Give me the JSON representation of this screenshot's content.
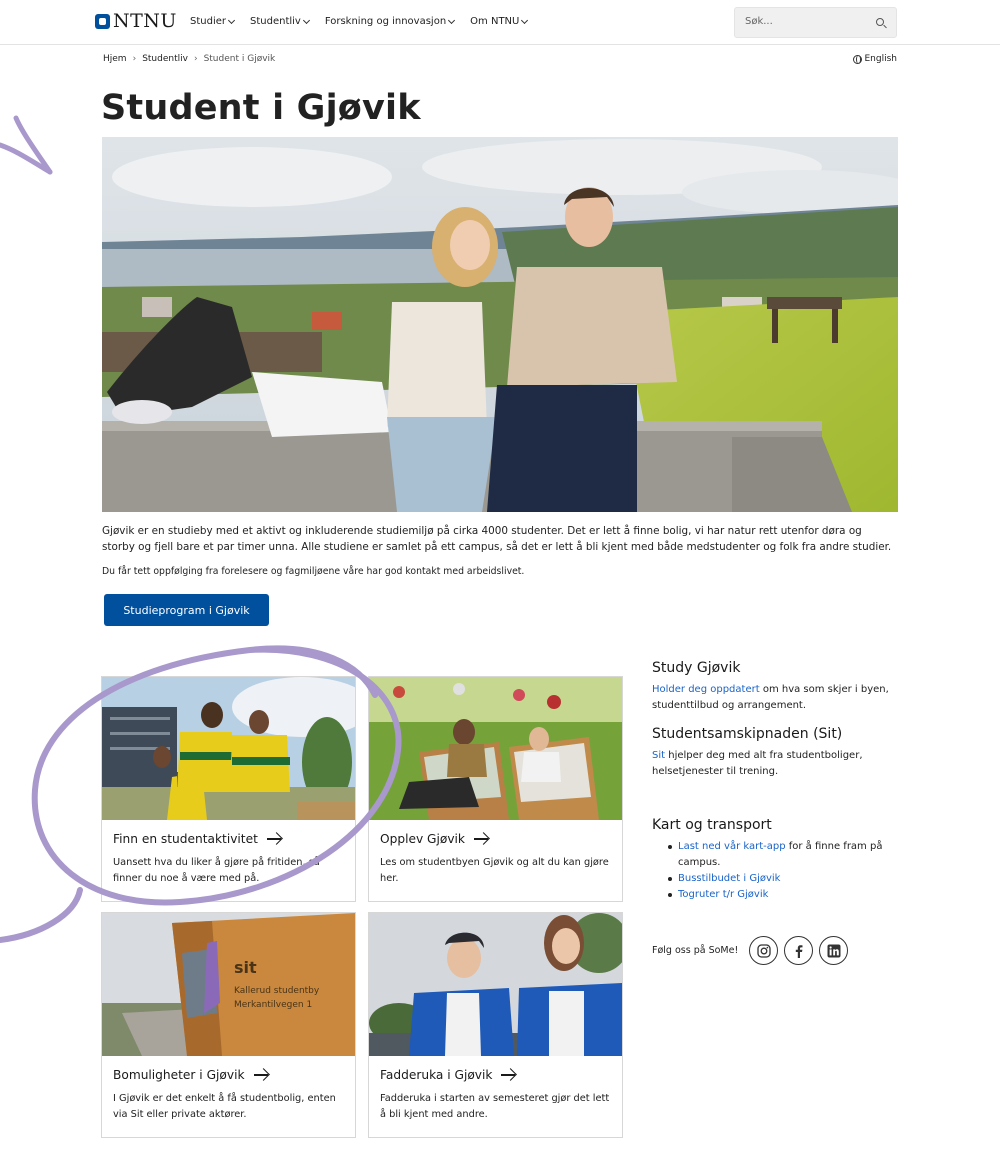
{
  "header": {
    "logo_text": "NTNU",
    "nav": [
      {
        "label": "Studier"
      },
      {
        "label": "Studentliv"
      },
      {
        "label": "Forskning og innovasjon"
      },
      {
        "label": "Om NTNU"
      }
    ],
    "search_placeholder": "Søk...",
    "brand_color": "#00509e"
  },
  "breadcrumb": {
    "items": [
      "Hjem",
      "Studentliv",
      "Student i Gjøvik"
    ]
  },
  "language_link": "English",
  "page": {
    "title": "Student i Gjøvik",
    "intro": "Gjøvik er en studieby med et aktivt og inkluderende studiemiljø på cirka 4000 studenter. Det er lett å finne bolig, vi har natur rett utenfor døra og storby og fjell bare et par timer unna. Alle studiene er samlet på ett campus, så det er lett å bli kjent med både medstudenter og folk fra andre studier.",
    "intro2": "Du får tett oppfølging fra forelesere og fagmiljøene våre har god kontakt med arbeidslivet.",
    "cta_label": "Studieprogram i Gjøvik"
  },
  "cards": [
    {
      "title": "Finn en studentaktivitet",
      "desc": "Uansett hva du liker å gjøre på fritiden, så finner du noe å være med på."
    },
    {
      "title": "Opplev Gjøvik",
      "desc": "Les om studentbyen Gjøvik og alt du kan gjøre her."
    },
    {
      "title": "Bomuligheter i Gjøvik",
      "desc": "I Gjøvik er det enkelt å få studentbolig, enten via Sit eller private aktører."
    },
    {
      "title": "Fadderuka i Gjøvik",
      "desc": "Fadderuka i starten av semesteret gjør det lett å bli kjent med andre."
    }
  ],
  "card_image_text": {
    "sign_brand": "sit",
    "sign_line1": "Kallerud studentby",
    "sign_line2": "Merkantilvegen 1"
  },
  "sidebar": {
    "study_title": "Study Gjøvik",
    "study_link": "Holder deg oppdatert",
    "study_text": " om hva som skjer i byen, studenttilbud og arrangement.",
    "sit_title": "Studentsamskipnaden (Sit)",
    "sit_link": "Sit",
    "sit_text": " hjelper deg med alt fra studentboliger, helsetjenester til trening.",
    "map_title": "Kart og transport",
    "map_item1_link": "Last ned vår kart-app",
    "map_item1_text": " for å finne fram på campus.",
    "map_item2_link": "Busstilbudet i Gjøvik",
    "map_item3_link": "Togruter t/r Gjøvik",
    "follow_label": "Følg oss på SoMe!",
    "social_icons": [
      "instagram-icon",
      "facebook-icon",
      "linkedin-icon"
    ]
  },
  "colors": {
    "link": "#1a64c8",
    "accent_purple": "#a898cc"
  }
}
